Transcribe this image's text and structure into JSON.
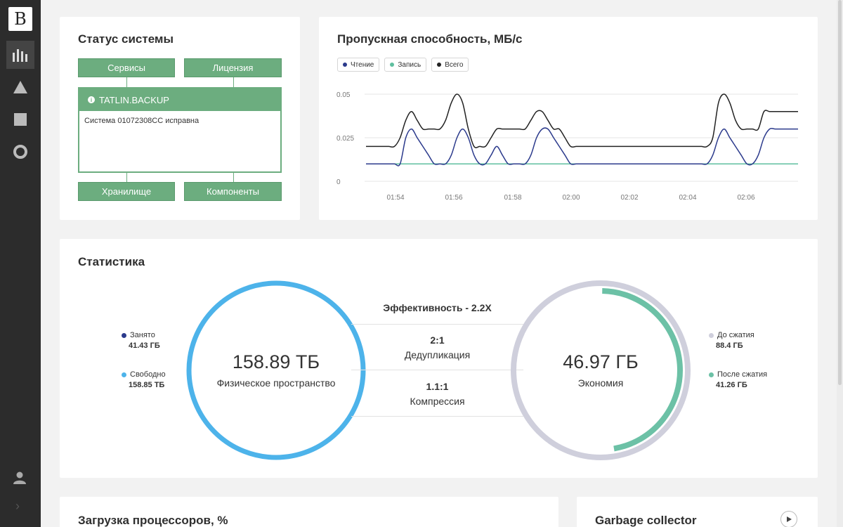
{
  "app": {
    "logo_letter": "B"
  },
  "sidebar": {
    "items": [
      {
        "icon": "bar-chart-icon",
        "active": true
      },
      {
        "icon": "triangle-icon",
        "active": false
      },
      {
        "icon": "square-icon",
        "active": false
      },
      {
        "icon": "circle-icon",
        "active": false
      }
    ],
    "bottom": [
      {
        "icon": "user-icon"
      },
      {
        "icon": "chevron-right-icon"
      }
    ]
  },
  "system_status": {
    "title": "Статус системы",
    "services_label": "Сервисы",
    "license_label": "Лицензия",
    "backup_title": "TATLIN.BACKUP",
    "backup_message": "Система 01072308CC исправна",
    "storage_label": "Хранилище",
    "components_label": "Компоненты",
    "accent_color": "#6cad7f"
  },
  "throughput": {
    "title": "Пропускная способность, МБ/с",
    "legend": [
      {
        "label": "Чтение",
        "color": "#2b3a8c"
      },
      {
        "label": "Запись",
        "color": "#5fbf9f"
      },
      {
        "label": "Всего",
        "color": "#222222"
      }
    ]
  },
  "chart_data": {
    "type": "line",
    "title": "Пропускная способность, МБ/с",
    "y_ticks": [
      "0.05",
      "0.025",
      "0"
    ],
    "x_ticks": [
      "01:54",
      "01:56",
      "01:58",
      "02:00",
      "02:02",
      "02:04",
      "02:06"
    ],
    "ylim": [
      0,
      0.05
    ],
    "x": [
      0,
      1,
      2,
      3,
      4,
      5,
      6,
      7,
      8,
      9,
      10,
      11,
      12,
      13,
      14,
      15,
      16,
      17,
      18,
      19,
      20,
      21,
      22,
      23,
      24,
      25,
      26,
      27,
      28,
      29,
      30,
      31,
      32,
      33,
      34,
      35,
      36,
      37,
      38,
      39,
      40,
      41,
      42,
      43,
      44,
      45,
      46,
      47,
      48,
      49,
      50,
      51,
      52,
      53,
      54,
      55,
      56,
      57,
      58,
      59,
      60,
      61,
      62,
      63,
      64,
      65,
      66,
      67,
      68,
      69,
      70,
      71,
      72,
      73,
      74,
      75,
      76
    ],
    "series": [
      {
        "name": "Чтение",
        "color": "#2b3a8c",
        "values": [
          0.01,
          0.01,
          0.01,
          0.01,
          0.01,
          0.01,
          0.01,
          0.025,
          0.03,
          0.025,
          0.02,
          0.015,
          0.01,
          0.01,
          0.01,
          0.015,
          0.025,
          0.03,
          0.025,
          0.015,
          0.01,
          0.01,
          0.015,
          0.02,
          0.015,
          0.01,
          0.01,
          0.01,
          0.01,
          0.015,
          0.025,
          0.03,
          0.03,
          0.025,
          0.02,
          0.015,
          0.01,
          0.01,
          0.01,
          0.01,
          0.01,
          0.01,
          0.01,
          0.01,
          0.01,
          0.01,
          0.01,
          0.01,
          0.01,
          0.01,
          0.01,
          0.01,
          0.01,
          0.01,
          0.01,
          0.01,
          0.01,
          0.01,
          0.01,
          0.01,
          0.01,
          0.015,
          0.025,
          0.03,
          0.025,
          0.02,
          0.015,
          0.01,
          0.01,
          0.015,
          0.025,
          0.03,
          0.03,
          0.03,
          0.03,
          0.03,
          0.03
        ]
      },
      {
        "name": "Запись",
        "color": "#5fbf9f",
        "values": [
          0.01,
          0.01,
          0.01,
          0.01,
          0.01,
          0.01,
          0.01,
          0.01,
          0.01,
          0.01,
          0.01,
          0.01,
          0.01,
          0.01,
          0.01,
          0.01,
          0.01,
          0.01,
          0.01,
          0.01,
          0.01,
          0.01,
          0.01,
          0.01,
          0.01,
          0.01,
          0.01,
          0.01,
          0.01,
          0.01,
          0.01,
          0.01,
          0.01,
          0.01,
          0.01,
          0.01,
          0.01,
          0.01,
          0.01,
          0.01,
          0.01,
          0.01,
          0.01,
          0.01,
          0.01,
          0.01,
          0.01,
          0.01,
          0.01,
          0.01,
          0.01,
          0.01,
          0.01,
          0.01,
          0.01,
          0.01,
          0.01,
          0.01,
          0.01,
          0.01,
          0.01,
          0.01,
          0.01,
          0.01,
          0.01,
          0.01,
          0.01,
          0.01,
          0.01,
          0.01,
          0.01,
          0.01,
          0.01,
          0.01,
          0.01,
          0.01,
          0.01
        ]
      },
      {
        "name": "Всего",
        "color": "#222222",
        "values": [
          0.02,
          0.02,
          0.02,
          0.02,
          0.02,
          0.02,
          0.025,
          0.035,
          0.04,
          0.035,
          0.03,
          0.03,
          0.03,
          0.03,
          0.035,
          0.045,
          0.05,
          0.045,
          0.03,
          0.02,
          0.02,
          0.02,
          0.025,
          0.03,
          0.03,
          0.03,
          0.03,
          0.03,
          0.03,
          0.035,
          0.04,
          0.04,
          0.035,
          0.03,
          0.03,
          0.025,
          0.02,
          0.02,
          0.02,
          0.02,
          0.02,
          0.02,
          0.02,
          0.02,
          0.02,
          0.02,
          0.02,
          0.02,
          0.02,
          0.02,
          0.02,
          0.02,
          0.02,
          0.02,
          0.02,
          0.02,
          0.02,
          0.02,
          0.02,
          0.02,
          0.02,
          0.025,
          0.045,
          0.05,
          0.045,
          0.035,
          0.03,
          0.03,
          0.03,
          0.03,
          0.04,
          0.04,
          0.04,
          0.04,
          0.04,
          0.04,
          0.04
        ]
      }
    ]
  },
  "statistics": {
    "title": "Статистика",
    "physical": {
      "value": "158.89 ТБ",
      "label": "Физическое пространство",
      "used_label": "Занято",
      "used_value": "41.43 ГБ",
      "free_label": "Свободно",
      "free_value": "158.85 ТБ",
      "used_color": "#2b3a8c",
      "free_color": "#4db3ea"
    },
    "efficiency": {
      "title": "Эффективность - 2.2X",
      "dedup_ratio": "2:1",
      "dedup_label": "Дедупликация",
      "compress_ratio": "1.1:1",
      "compress_label": "Компрессия"
    },
    "savings": {
      "value": "46.97 ГБ",
      "label": "Экономия",
      "before_label": "До сжатия",
      "before_value": "88.4 ГБ",
      "after_label": "После сжатия",
      "after_value": "41.26 ГБ",
      "before_color": "#cfcfdc",
      "after_color": "#6cc1a6",
      "after_fraction": 0.47
    }
  },
  "cpu_panel": {
    "title": "Загрузка процессоров, %"
  },
  "gc_panel": {
    "title": "Garbage collector"
  }
}
